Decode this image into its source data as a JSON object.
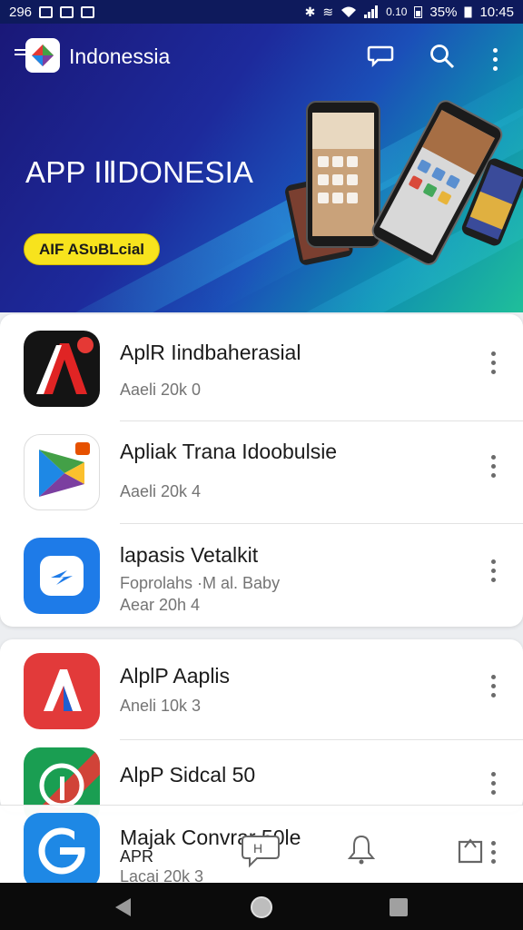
{
  "status_bar": {
    "left_text": "296",
    "clock_a": "0.10",
    "battery": "35%",
    "time": "10:45"
  },
  "header": {
    "title": "Indonessia"
  },
  "banner": {
    "heading": "APP IⅡDONESIA",
    "cta": "AIF ASᴜBLcial"
  },
  "apps_primary": [
    {
      "name": "AplR Iindbaherasial",
      "meta1": "Aaeli 20k  0",
      "icon": "red-a-logo-icon"
    },
    {
      "name": "Apliak Trana Idoobulsie",
      "meta1": "Aaeli 20k  4",
      "icon": "play-triangle-logo-icon"
    },
    {
      "name": "lapasis Vetalkit",
      "meta1": "Foprolahs ·M al. Baby",
      "meta2": "Aear 20h  4",
      "icon": "blue-share-logo-icon"
    }
  ],
  "apps_secondary": [
    {
      "name": "AlplP Aaplis",
      "meta1": "Aneli 10k  3",
      "icon": "red-a-logo-icon"
    },
    {
      "name": "AlpP Sidcal 50",
      "icon": "green-pin-logo-icon"
    },
    {
      "name": "Majak Convrar 50le",
      "meta1": "APR",
      "meta2": "Lacai 20k  3",
      "icon": "blue-g-logo-icon"
    }
  ],
  "colors": {
    "hero_start": "#1a1878",
    "hero_end": "#1fbf9a",
    "cta": "#f7e31d",
    "nav_bar": "#0b0b0b"
  }
}
